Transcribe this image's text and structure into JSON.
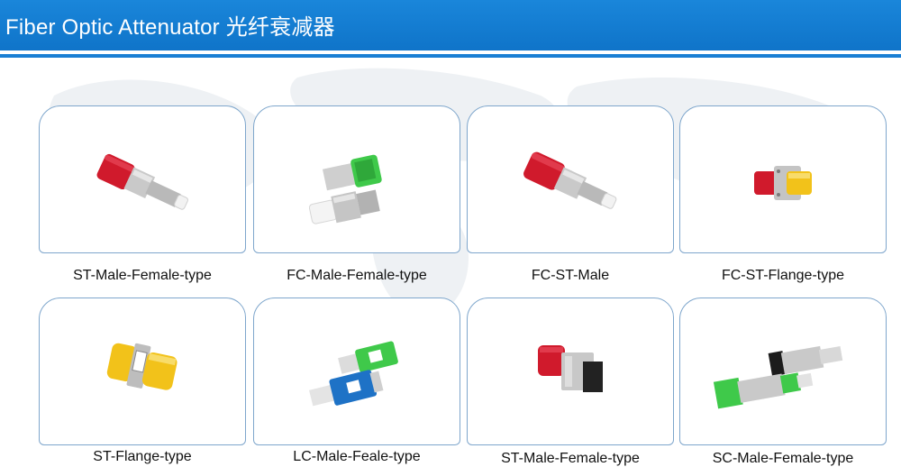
{
  "header": {
    "title": "Fiber Optic Attenuator 光纤衰减器"
  },
  "colors": {
    "header_blue": "#1383d6",
    "card_border": "#7ea6cc",
    "red_cap": "#d01a2c",
    "yellow_cap": "#f2c21a",
    "green_cap": "#3fc94a",
    "blue_body": "#1e72c6"
  },
  "products": [
    {
      "caption": "ST-Male-Female-type",
      "image": "st-male-female-attenuator-photo"
    },
    {
      "caption": "FC-Male-Female-type",
      "image": "fc-male-female-attenuator-photo"
    },
    {
      "caption": "FC-ST-Male",
      "image": "fc-st-male-attenuator-photo"
    },
    {
      "caption": "FC-ST-Flange-type",
      "image": "fc-st-flange-attenuator-photo"
    },
    {
      "caption": "ST-Flange-type",
      "image": "st-flange-attenuator-photo"
    },
    {
      "caption": "LC-Male-Feale-type",
      "image": "lc-male-female-attenuator-photo"
    },
    {
      "caption": "ST-Male-Female-type",
      "image": "st-sc-male-female-attenuator-photo"
    },
    {
      "caption": "SC-Male-Female-type",
      "image": "sc-male-female-attenuator-photo"
    }
  ]
}
